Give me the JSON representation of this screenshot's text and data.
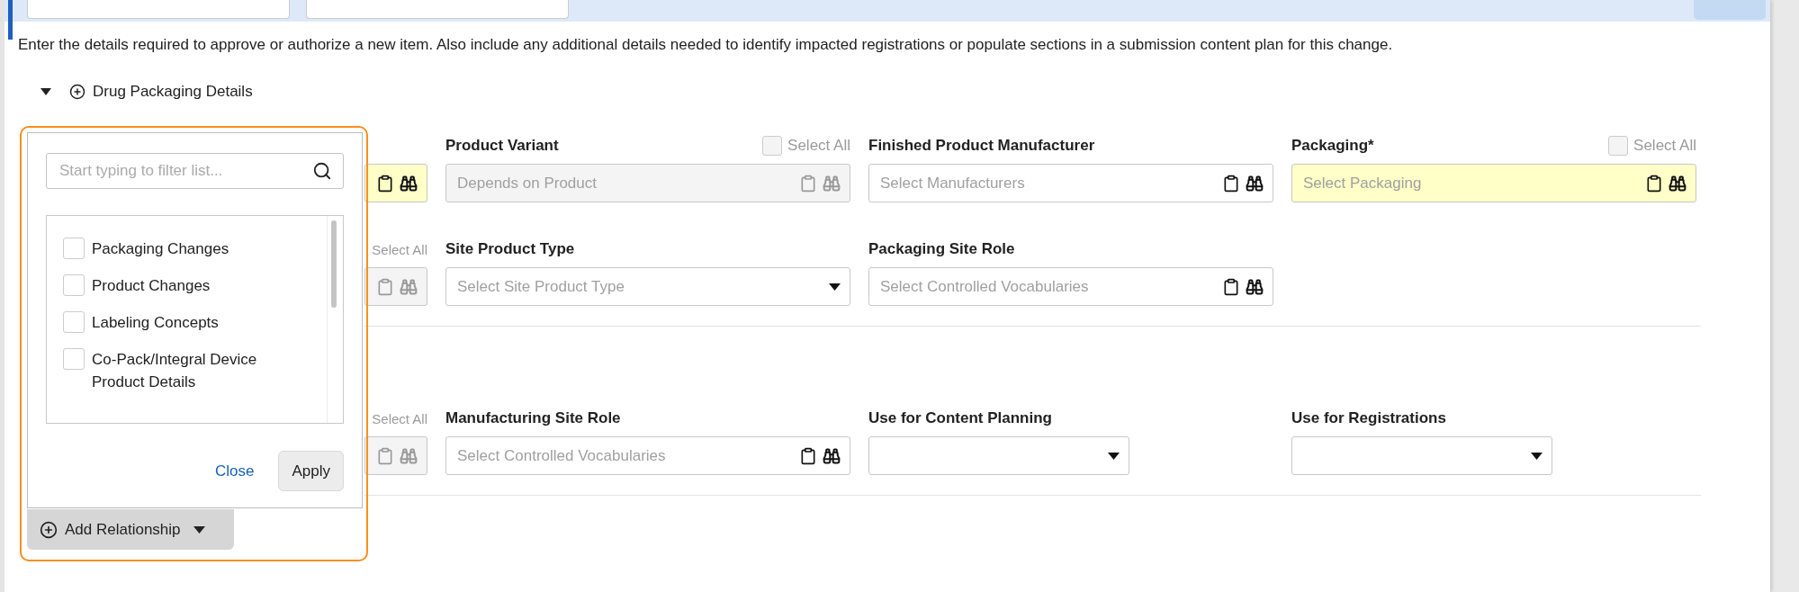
{
  "description": "Enter the details required to approve or authorize a new item. Also include any additional details needed to identify impacted registrations or populate sections in a submission content plan for this change.",
  "section": {
    "title": "Drug Packaging Details",
    "expanded": true
  },
  "groups": [
    {
      "rows": [
        {
          "cells": [
            {
              "kind": "lookup",
              "required": true,
              "disabled": false
            },
            {
              "kind": "lookup",
              "label": "Product Variant",
              "placeholder": "Depends on Product",
              "required": false,
              "disabled": true,
              "select_all": {
                "label": "Select All",
                "checked": false
              }
            },
            {
              "kind": "lookup",
              "label": "Finished Product Manufacturer",
              "placeholder": "Select Manufacturers",
              "required": false,
              "disabled": false
            },
            {
              "kind": "lookup",
              "label": "Packaging*",
              "placeholder": "Select Packaging",
              "required": true,
              "disabled": false,
              "select_all": {
                "label": "Select All",
                "checked": false
              }
            }
          ]
        },
        {
          "cells": [
            {
              "kind": "lookup",
              "required": false,
              "disabled": true,
              "select_all": {
                "label": "Select All"
              }
            },
            {
              "kind": "select",
              "label": "Site Product Type",
              "placeholder": "Select Site Product Type",
              "required": false,
              "disabled": false
            },
            {
              "kind": "lookup",
              "label": "Packaging Site Role",
              "placeholder": "Select Controlled Vocabularies",
              "required": false,
              "disabled": false
            }
          ]
        }
      ]
    },
    {
      "rows": [
        {
          "cells": [
            {
              "kind": "lookup",
              "required": false,
              "disabled": true,
              "select_all": {
                "label": "Select All"
              }
            },
            {
              "kind": "lookup",
              "label": "Manufacturing Site Role",
              "placeholder": "Select Controlled Vocabularies",
              "required": false,
              "disabled": false
            },
            {
              "kind": "select",
              "label": "Use for Content Planning",
              "required": false,
              "disabled": false,
              "narrow": true
            },
            {
              "kind": "select",
              "label": "Use for Registrations",
              "required": false,
              "disabled": false,
              "narrow": true
            }
          ]
        }
      ]
    }
  ],
  "popup": {
    "filter_placeholder": "Start typing to filter list...",
    "options": [
      {
        "label": "Packaging Changes",
        "checked": false
      },
      {
        "label": "Product Changes",
        "checked": false
      },
      {
        "label": "Labeling Concepts",
        "checked": false
      },
      {
        "label": "Co-Pack/Integral Device Product Details",
        "checked": false
      }
    ],
    "close": "Close",
    "apply": "Apply"
  },
  "add_relationship": "Add Relationship"
}
